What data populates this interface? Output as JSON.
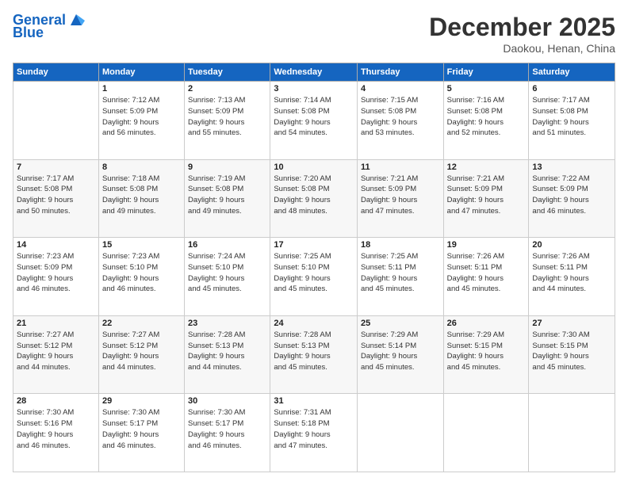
{
  "logo": {
    "line1": "General",
    "line2": "Blue"
  },
  "title": "December 2025",
  "location": "Daokou, Henan, China",
  "days_of_week": [
    "Sunday",
    "Monday",
    "Tuesday",
    "Wednesday",
    "Thursday",
    "Friday",
    "Saturday"
  ],
  "weeks": [
    [
      {
        "day": "",
        "info": ""
      },
      {
        "day": "1",
        "info": "Sunrise: 7:12 AM\nSunset: 5:09 PM\nDaylight: 9 hours\nand 56 minutes."
      },
      {
        "day": "2",
        "info": "Sunrise: 7:13 AM\nSunset: 5:09 PM\nDaylight: 9 hours\nand 55 minutes."
      },
      {
        "day": "3",
        "info": "Sunrise: 7:14 AM\nSunset: 5:08 PM\nDaylight: 9 hours\nand 54 minutes."
      },
      {
        "day": "4",
        "info": "Sunrise: 7:15 AM\nSunset: 5:08 PM\nDaylight: 9 hours\nand 53 minutes."
      },
      {
        "day": "5",
        "info": "Sunrise: 7:16 AM\nSunset: 5:08 PM\nDaylight: 9 hours\nand 52 minutes."
      },
      {
        "day": "6",
        "info": "Sunrise: 7:17 AM\nSunset: 5:08 PM\nDaylight: 9 hours\nand 51 minutes."
      }
    ],
    [
      {
        "day": "7",
        "info": "Sunrise: 7:17 AM\nSunset: 5:08 PM\nDaylight: 9 hours\nand 50 minutes."
      },
      {
        "day": "8",
        "info": "Sunrise: 7:18 AM\nSunset: 5:08 PM\nDaylight: 9 hours\nand 49 minutes."
      },
      {
        "day": "9",
        "info": "Sunrise: 7:19 AM\nSunset: 5:08 PM\nDaylight: 9 hours\nand 49 minutes."
      },
      {
        "day": "10",
        "info": "Sunrise: 7:20 AM\nSunset: 5:08 PM\nDaylight: 9 hours\nand 48 minutes."
      },
      {
        "day": "11",
        "info": "Sunrise: 7:21 AM\nSunset: 5:09 PM\nDaylight: 9 hours\nand 47 minutes."
      },
      {
        "day": "12",
        "info": "Sunrise: 7:21 AM\nSunset: 5:09 PM\nDaylight: 9 hours\nand 47 minutes."
      },
      {
        "day": "13",
        "info": "Sunrise: 7:22 AM\nSunset: 5:09 PM\nDaylight: 9 hours\nand 46 minutes."
      }
    ],
    [
      {
        "day": "14",
        "info": "Sunrise: 7:23 AM\nSunset: 5:09 PM\nDaylight: 9 hours\nand 46 minutes."
      },
      {
        "day": "15",
        "info": "Sunrise: 7:23 AM\nSunset: 5:10 PM\nDaylight: 9 hours\nand 46 minutes."
      },
      {
        "day": "16",
        "info": "Sunrise: 7:24 AM\nSunset: 5:10 PM\nDaylight: 9 hours\nand 45 minutes."
      },
      {
        "day": "17",
        "info": "Sunrise: 7:25 AM\nSunset: 5:10 PM\nDaylight: 9 hours\nand 45 minutes."
      },
      {
        "day": "18",
        "info": "Sunrise: 7:25 AM\nSunset: 5:11 PM\nDaylight: 9 hours\nand 45 minutes."
      },
      {
        "day": "19",
        "info": "Sunrise: 7:26 AM\nSunset: 5:11 PM\nDaylight: 9 hours\nand 45 minutes."
      },
      {
        "day": "20",
        "info": "Sunrise: 7:26 AM\nSunset: 5:11 PM\nDaylight: 9 hours\nand 44 minutes."
      }
    ],
    [
      {
        "day": "21",
        "info": "Sunrise: 7:27 AM\nSunset: 5:12 PM\nDaylight: 9 hours\nand 44 minutes."
      },
      {
        "day": "22",
        "info": "Sunrise: 7:27 AM\nSunset: 5:12 PM\nDaylight: 9 hours\nand 44 minutes."
      },
      {
        "day": "23",
        "info": "Sunrise: 7:28 AM\nSunset: 5:13 PM\nDaylight: 9 hours\nand 44 minutes."
      },
      {
        "day": "24",
        "info": "Sunrise: 7:28 AM\nSunset: 5:13 PM\nDaylight: 9 hours\nand 45 minutes."
      },
      {
        "day": "25",
        "info": "Sunrise: 7:29 AM\nSunset: 5:14 PM\nDaylight: 9 hours\nand 45 minutes."
      },
      {
        "day": "26",
        "info": "Sunrise: 7:29 AM\nSunset: 5:15 PM\nDaylight: 9 hours\nand 45 minutes."
      },
      {
        "day": "27",
        "info": "Sunrise: 7:30 AM\nSunset: 5:15 PM\nDaylight: 9 hours\nand 45 minutes."
      }
    ],
    [
      {
        "day": "28",
        "info": "Sunrise: 7:30 AM\nSunset: 5:16 PM\nDaylight: 9 hours\nand 46 minutes."
      },
      {
        "day": "29",
        "info": "Sunrise: 7:30 AM\nSunset: 5:17 PM\nDaylight: 9 hours\nand 46 minutes."
      },
      {
        "day": "30",
        "info": "Sunrise: 7:30 AM\nSunset: 5:17 PM\nDaylight: 9 hours\nand 46 minutes."
      },
      {
        "day": "31",
        "info": "Sunrise: 7:31 AM\nSunset: 5:18 PM\nDaylight: 9 hours\nand 47 minutes."
      },
      {
        "day": "",
        "info": ""
      },
      {
        "day": "",
        "info": ""
      },
      {
        "day": "",
        "info": ""
      }
    ]
  ]
}
